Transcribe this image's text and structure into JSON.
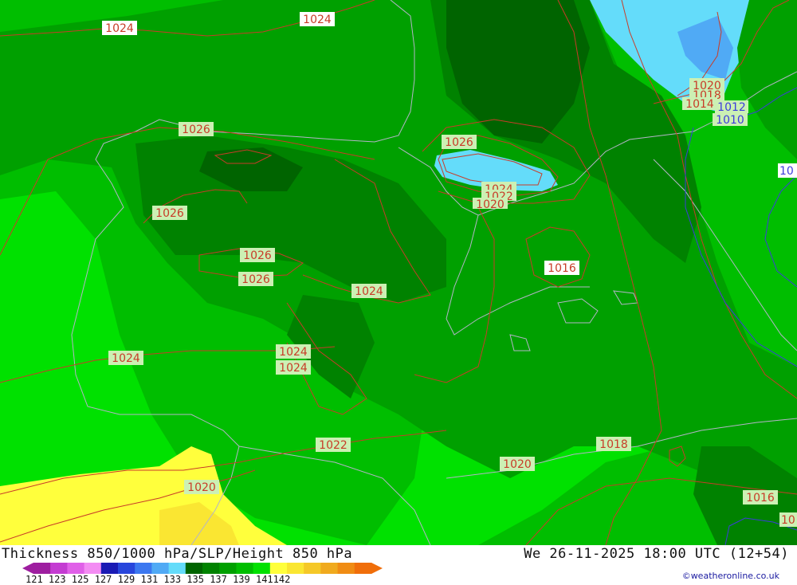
{
  "header": {
    "title": "Thickness 850/1000 hPa/SLP/Height 850 hPa",
    "valid_time": "We 26-11-2025 18:00 UTC (12+54)"
  },
  "legend": {
    "ticks_text": "121 123 125 127 129 131 133 135 137 139 141142",
    "colors": [
      "#9e1ea0",
      "#c43cd2",
      "#e060e8",
      "#f38cf3",
      "#1a1ab4",
      "#2846dc",
      "#3c78f0",
      "#50aaf5",
      "#64dcfa",
      "#006400",
      "#008200",
      "#00a000",
      "#00be00",
      "#00e100",
      "#ffff3c",
      "#fae632",
      "#f5c828",
      "#f0aa1e",
      "#f08c14",
      "#f06e0a"
    ]
  },
  "isobar_labels": [
    {
      "text": "1024",
      "tone": "pink"
    },
    {
      "text": "1024",
      "tone": "pink"
    },
    {
      "text": "1026",
      "tone": "green"
    },
    {
      "text": "1026",
      "tone": "green"
    },
    {
      "text": "1026",
      "tone": "green"
    },
    {
      "text": "1026",
      "tone": "green"
    },
    {
      "text": "1026",
      "tone": "green"
    },
    {
      "text": "1024",
      "tone": "green"
    },
    {
      "text": "1024",
      "tone": "green"
    },
    {
      "text": "1022",
      "tone": "green"
    },
    {
      "text": "1020",
      "tone": "green"
    },
    {
      "text": "1024",
      "tone": "green"
    },
    {
      "text": "1024",
      "tone": "green"
    },
    {
      "text": "1024",
      "tone": "green"
    },
    {
      "text": "1022",
      "tone": "pink"
    },
    {
      "text": "1020",
      "tone": "pink"
    },
    {
      "text": "1016",
      "tone": "pink"
    },
    {
      "text": "1020",
      "tone": "green"
    },
    {
      "text": "1018",
      "tone": "green"
    },
    {
      "text": "1016",
      "tone": "green"
    },
    {
      "text": "1020",
      "tone": "green"
    },
    {
      "text": "1018",
      "tone": "green"
    },
    {
      "text": "1014",
      "tone": "green"
    },
    {
      "text": "1012",
      "tone": "blue"
    },
    {
      "text": "1010",
      "tone": "blue"
    },
    {
      "text": "10",
      "tone": "blue"
    },
    {
      "text": "10",
      "tone": "green"
    }
  ],
  "credit": "©weatheronline.co.uk"
}
